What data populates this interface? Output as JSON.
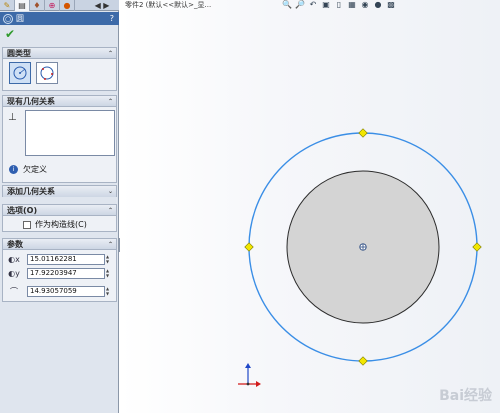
{
  "document": {
    "title": "零件2 (默认<<默认>_显..."
  },
  "panel": {
    "tabs": [
      {
        "icon": "feature-manager-icon"
      },
      {
        "icon": "property-manager-icon"
      },
      {
        "icon": "configuration-manager-icon"
      },
      {
        "icon": "dimxpert-icon"
      },
      {
        "icon": "display-manager-icon"
      }
    ],
    "title": "圆",
    "help": "?",
    "groups": {
      "circle_type": {
        "label": "圆类型",
        "options": [
          "center-circle",
          "perimeter-circle"
        ],
        "selected": "center-circle"
      },
      "existing_relations": {
        "label": "现有几何关系",
        "status": "欠定义"
      },
      "add_relations": {
        "label": "添加几何关系"
      },
      "options": {
        "label": "选项(O)",
        "checkbox_label": "作为构造线(C)",
        "checked": false
      },
      "parameters": {
        "label": "参数",
        "center_x": "15.01162281",
        "center_y": "17.92203947",
        "radius": "14.93057059"
      }
    }
  },
  "graphics": {
    "watermark": "Bai经验",
    "colors": {
      "outer_circle": "#3a8ee6",
      "handle": "#f2e600",
      "fill": "#d4d4d4",
      "axis_x": "#d11a1a",
      "axis_y": "#2047c8"
    }
  }
}
